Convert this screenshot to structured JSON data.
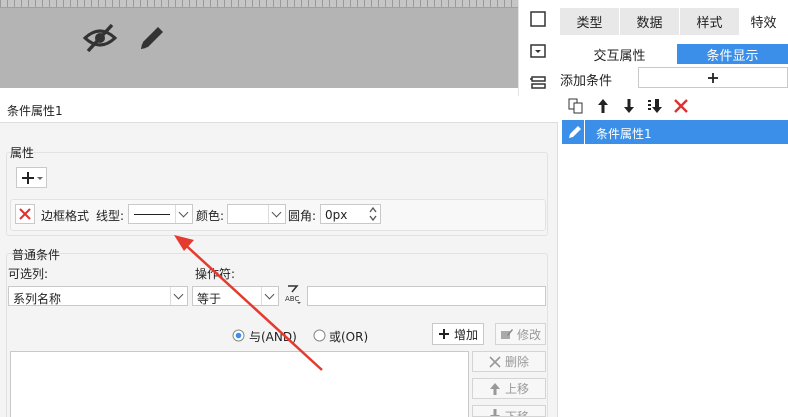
{
  "main": {
    "title": "条件属性1",
    "attr_group_label": "属性",
    "border": {
      "label": "边框格式",
      "line_type_label": "线型:",
      "color_label": "颜色:",
      "radius_label": "圆角:",
      "radius_value": "0px"
    },
    "common_group_label": "普通条件",
    "optional_col_label": "可选列:",
    "operator_label": "操作符:",
    "column_value": "系列名称",
    "operator_value": "等于",
    "and_label": "与(AND)",
    "or_label": "或(OR)",
    "add_label": "增加",
    "modify_label": "修改",
    "delete_label": "删除",
    "move_up_label": "上移",
    "move_down_label": "下移"
  },
  "right": {
    "tabs": [
      "类型",
      "数据",
      "样式",
      "特效"
    ],
    "subtabs": [
      "交互属性",
      "条件显示"
    ],
    "add_condition_label": "添加条件",
    "condition_item": "条件属性1"
  },
  "colors": {
    "accent": "#3b8fe8",
    "danger": "#e03030",
    "arrow": "#e53b2f"
  }
}
